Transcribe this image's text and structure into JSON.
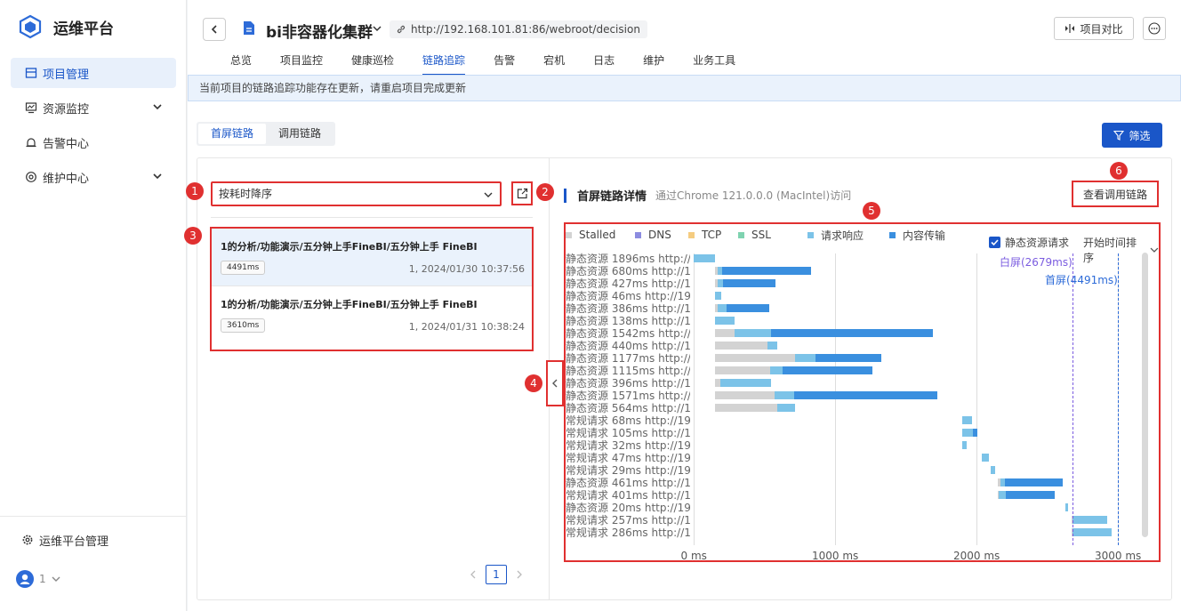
{
  "sidebar": {
    "brand": "运维平台",
    "items": [
      {
        "label": "项目管理"
      },
      {
        "label": "资源监控"
      },
      {
        "label": "告警中心"
      },
      {
        "label": "维护中心"
      }
    ],
    "footer": "运维平台管理",
    "user": "1"
  },
  "header": {
    "title": "bi非容器化集群",
    "url": "http://192.168.101.81:86/webroot/decision",
    "compare": "项目对比",
    "tabs": [
      "总览",
      "项目监控",
      "健康巡检",
      "链路追踪",
      "告警",
      "宕机",
      "日志",
      "维护",
      "业务工具"
    ]
  },
  "notice": "当前项目的链路追踪功能存在更新，请重启项目完成更新",
  "segments": [
    "首屏链路",
    "调用链路"
  ],
  "filter": "筛选",
  "sort": "按耗时降序",
  "traces": [
    {
      "title": "1的分析/功能演示/五分钟上手FineBI/五分钟上手 FineBI",
      "ms": "4491ms",
      "date": "1, 2024/01/30 10:37:56"
    },
    {
      "title": "1的分析/功能演示/五分钟上手FineBI/五分钟上手 FineBI",
      "ms": "3610ms",
      "date": "1, 2024/01/31 10:38:24"
    }
  ],
  "page": "1",
  "detail": {
    "title": "首屏链路详情",
    "sub": "通过Chrome 121.0.0.0 (MacIntel)访问",
    "call_button": "查看调用链路",
    "static_label": "静态资源请求",
    "sort_label": "开始时间排序",
    "white": "白屏(2679ms)",
    "first": "首屏(4491ms)"
  },
  "badges": [
    "1",
    "2",
    "3",
    "4",
    "5",
    "6"
  ],
  "legend": [
    {
      "name": "Stalled",
      "color": "#d3d3d3"
    },
    {
      "name": "DNS",
      "color": "#8c8ce0"
    },
    {
      "name": "TCP",
      "color": "#f5cc80"
    },
    {
      "name": "SSL",
      "color": "#7fd3b0"
    },
    {
      "name": "请求响应",
      "color": "#7cc3e8"
    },
    {
      "name": "内容传输",
      "color": "#3a8fdf"
    }
  ],
  "chart_data": {
    "type": "bar",
    "xlabel": "",
    "ylabel": "",
    "xlim": [
      0,
      3200
    ],
    "xticks": [
      "0 ms",
      "1000 ms",
      "2000 ms",
      "3000 ms"
    ],
    "rows": [
      {
        "label": "静态资源 1896ms http://...",
        "start": 0,
        "segs": [
          [
            "请求响应",
            150
          ]
        ]
      },
      {
        "label": "静态资源 680ms http://1...",
        "start": 150,
        "segs": [
          [
            "Stalled",
            20
          ],
          [
            "请求响应",
            30
          ],
          [
            "内容传输",
            630
          ]
        ]
      },
      {
        "label": "静态资源 427ms http://1...",
        "start": 150,
        "segs": [
          [
            "Stalled",
            20
          ],
          [
            "请求响应",
            40
          ],
          [
            "内容传输",
            367
          ]
        ]
      },
      {
        "label": "静态资源 46ms http://19...",
        "start": 150,
        "segs": [
          [
            "请求响应",
            46
          ]
        ]
      },
      {
        "label": "静态资源 386ms http://1...",
        "start": 150,
        "segs": [
          [
            "Stalled",
            20
          ],
          [
            "请求响应",
            60
          ],
          [
            "内容传输",
            306
          ]
        ]
      },
      {
        "label": "静态资源 138ms http://1...",
        "start": 150,
        "segs": [
          [
            "请求响应",
            138
          ]
        ]
      },
      {
        "label": "静态资源 1542ms http://...",
        "start": 150,
        "segs": [
          [
            "Stalled",
            140
          ],
          [
            "请求响应",
            260
          ],
          [
            "内容传输",
            1142
          ]
        ]
      },
      {
        "label": "静态资源 440ms http://1...",
        "start": 150,
        "segs": [
          [
            "Stalled",
            370
          ],
          [
            "请求响应",
            70
          ]
        ]
      },
      {
        "label": "静态资源 1177ms http://...",
        "start": 150,
        "segs": [
          [
            "Stalled",
            570
          ],
          [
            "请求响应",
            140
          ],
          [
            "内容传输",
            467
          ]
        ]
      },
      {
        "label": "静态资源 1115ms http://...",
        "start": 150,
        "segs": [
          [
            "Stalled",
            390
          ],
          [
            "请求响应",
            90
          ],
          [
            "内容传输",
            635
          ]
        ]
      },
      {
        "label": "静态资源 396ms http://1...",
        "start": 150,
        "segs": [
          [
            "Stalled",
            40
          ],
          [
            "请求响应",
            356
          ]
        ]
      },
      {
        "label": "静态资源 1571ms http://...",
        "start": 150,
        "segs": [
          [
            "Stalled",
            420
          ],
          [
            "请求响应",
            140
          ],
          [
            "内容传输",
            1011
          ]
        ]
      },
      {
        "label": "静态资源 564ms http://1...",
        "start": 150,
        "segs": [
          [
            "Stalled",
            440
          ],
          [
            "请求响应",
            124
          ]
        ]
      },
      {
        "label": "常规请求 68ms http://19...",
        "start": 1900,
        "segs": [
          [
            "请求响应",
            68
          ]
        ]
      },
      {
        "label": "常规请求 105ms http://1...",
        "start": 1900,
        "segs": [
          [
            "请求响应",
            75
          ],
          [
            "内容传输",
            30
          ]
        ]
      },
      {
        "label": "常规请求 32ms http://19...",
        "start": 1900,
        "segs": [
          [
            "请求响应",
            32
          ]
        ]
      },
      {
        "label": "常规请求 47ms http://19...",
        "start": 2040,
        "segs": [
          [
            "请求响应",
            47
          ]
        ]
      },
      {
        "label": "常规请求 29ms http://19...",
        "start": 2100,
        "segs": [
          [
            "请求响应",
            29
          ]
        ]
      },
      {
        "label": "静态资源 461ms http://1...",
        "start": 2150,
        "segs": [
          [
            "Stalled",
            20
          ],
          [
            "请求响应",
            30
          ],
          [
            "内容传输",
            411
          ]
        ]
      },
      {
        "label": "常规请求 401ms http://1...",
        "start": 2150,
        "segs": [
          [
            "Stalled",
            10
          ],
          [
            "请求响应",
            50
          ],
          [
            "内容传输",
            341
          ]
        ]
      },
      {
        "label": "静态资源 20ms http://19...",
        "start": 2630,
        "segs": [
          [
            "请求响应",
            20
          ]
        ]
      },
      {
        "label": "常规请求 257ms http://1...",
        "start": 2670,
        "segs": [
          [
            "Stalled",
            10
          ],
          [
            "请求响应",
            247
          ]
        ]
      },
      {
        "label": "常规请求 286ms http://1...",
        "start": 2670,
        "segs": [
          [
            "Stalled",
            10
          ],
          [
            "请求响应",
            276
          ]
        ]
      }
    ],
    "markers": [
      {
        "name": "白屏(2679ms)",
        "value": 2679
      },
      {
        "name": "首屏(4491ms)",
        "value": 3000
      }
    ]
  }
}
